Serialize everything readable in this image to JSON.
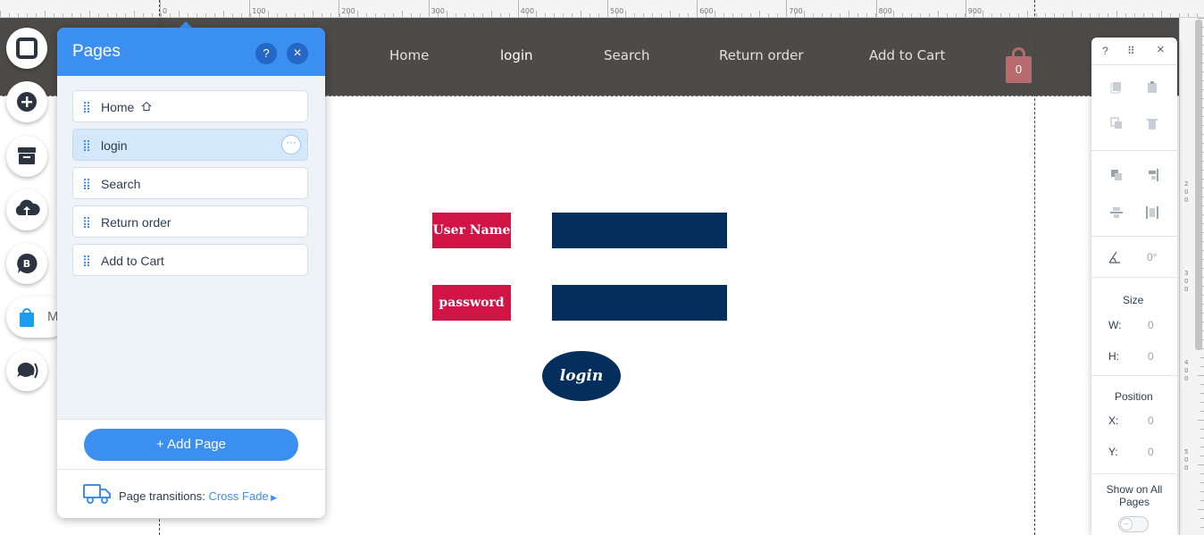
{
  "ruler": {
    "top_labels": [
      "0",
      "100",
      "200",
      "300",
      "400",
      "500",
      "600",
      "700",
      "800",
      "900"
    ],
    "right_labels": [
      "2",
      "0",
      "0",
      "3",
      "0",
      "0",
      "4",
      "0",
      "0",
      "5",
      "0",
      "0"
    ]
  },
  "site": {
    "menu": [
      "Home",
      "login",
      "Search",
      "Return order",
      "Add to Cart"
    ],
    "active_menu": "login",
    "cart_count": "0"
  },
  "left_toolbar": {
    "items": [
      "menus-icon",
      "add-icon",
      "store-icon",
      "upload-icon",
      "blog-icon",
      "shopping-bag-icon",
      "chat-icon"
    ],
    "pill_label": "M"
  },
  "pages_panel": {
    "title": "Pages",
    "help": "?",
    "close": "×",
    "pages": [
      {
        "name": "Home",
        "is_home": true
      },
      {
        "name": "login",
        "selected": true
      },
      {
        "name": "Search"
      },
      {
        "name": "Return order"
      },
      {
        "name": "Add to Cart"
      }
    ],
    "more_label": "···",
    "add_page_label": "+  Add Page",
    "transitions_label": "Page transitions:",
    "transitions_value": "Cross Fade"
  },
  "form": {
    "username_label": "User Name",
    "password_label": "password",
    "login_button": "login"
  },
  "inspector": {
    "help": "?",
    "drag": "⠿",
    "close": "×",
    "rotation": "0°",
    "size_title": "Size",
    "w_label": "W:",
    "w_value": "0",
    "h_label": "H:",
    "h_value": "0",
    "position_title": "Position",
    "x_label": "X:",
    "x_value": "0",
    "y_label": "Y:",
    "y_value": "0",
    "show_all_pages": "Show on All Pages",
    "toggle_symbol": "–"
  },
  "colors": {
    "header_bg": "#4d4a4a",
    "accent_blue": "#3b8ff1",
    "label_red": "#d21346",
    "input_navy": "#042e5c",
    "cart": "#b86b6f"
  }
}
